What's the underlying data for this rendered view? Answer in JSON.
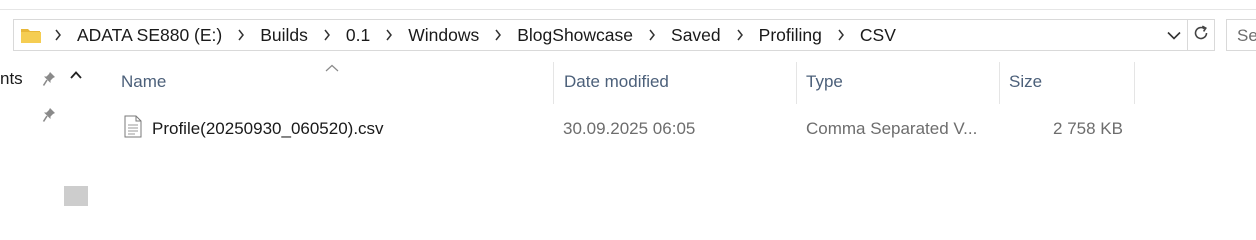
{
  "address_bar": {
    "folder_icon": "folder-icon",
    "separator_icon": "chevron-right-icon",
    "crumbs": [
      "ADATA SE880 (E:)",
      "Builds",
      "0.1",
      "Windows",
      "BlogShowcase",
      "Saved",
      "Profiling",
      "CSV"
    ],
    "dropdown_icon": "chevron-down-icon",
    "refresh_icon": "refresh-icon"
  },
  "search": {
    "placeholder": "Se"
  },
  "nav_pane": {
    "partial_item_label": "nts",
    "pin_icon": "pin-icon",
    "scroll_up_icon": "chevron-up-icon"
  },
  "columns": {
    "name": "Name",
    "date_modified": "Date modified",
    "type": "Type",
    "size": "Size",
    "sort_icon": "sort-ascending-icon"
  },
  "files": [
    {
      "name": "Profile(20250930_060520).csv",
      "date_modified": "30.09.2025 06:05",
      "type": "Comma Separated V...",
      "size": "2 758 KB",
      "icon": "csv-file-icon"
    }
  ],
  "colors": {
    "header_text": "#4c607a",
    "muted_text": "#6d6d6d",
    "folder": "#e8b738",
    "border": "#d9d9d9"
  }
}
